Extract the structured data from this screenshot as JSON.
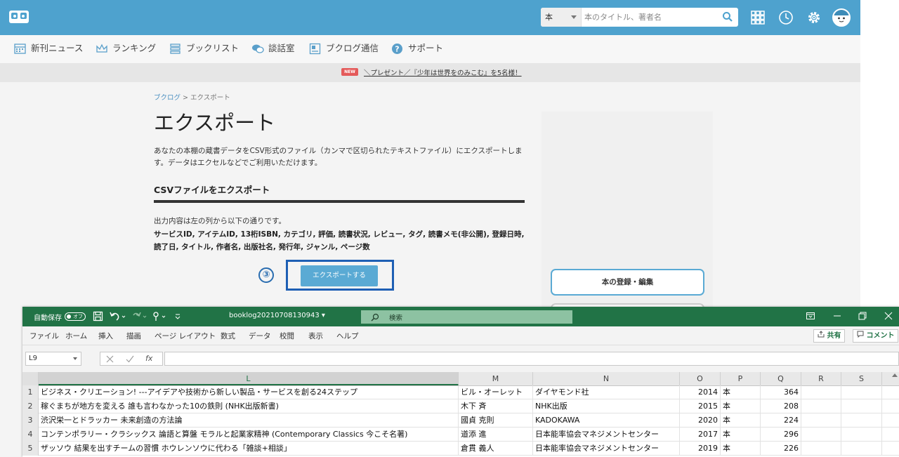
{
  "web": {
    "search": {
      "category": "本",
      "placeholder": "本のタイトル、著者名"
    },
    "nav": [
      {
        "label": "新刊ニュース"
      },
      {
        "label": "ランキング"
      },
      {
        "label": "ブックリスト"
      },
      {
        "label": "談話室"
      },
      {
        "label": "ブクログ通信"
      },
      {
        "label": "サポート"
      }
    ],
    "promo": {
      "badge": "NEW",
      "text": "＼プレゼント／『少年は世界をのみこむ』を5名様！"
    },
    "breadcrumb": {
      "home": "ブクログ",
      "sep": " > ",
      "current": "エクスポート"
    },
    "title": "エクスポート",
    "description": "あなたの本棚の蔵書データをCSV形式のファイル（カンマで区切られたテキストファイル）にエクスポートします。データはエクセルなどでご利用いただけます。",
    "section_title": "CSVファイルをエクスポート",
    "output_intro": "出力内容は左の列から以下の通りです。",
    "output_fields": "サービスID, アイテムID, 13桁ISBN, カテゴリ, 評価, 読書状況, レビュー, タグ, 読書メモ(非公開), 登録日時, 読了日, タイトル, 作者名, 出版社名, 発行年, ジャンル, ページ数",
    "step_marker": "③",
    "export_button": "エクスポートする",
    "side_button": "本の登録・編集"
  },
  "excel": {
    "autosave_label": "自動保存",
    "autosave_state": "オフ",
    "file_name": "booklog20210708130943",
    "search_label": "検索",
    "tabs": [
      "ファイル",
      "ホーム",
      "挿入",
      "描画",
      "ページ レイアウト",
      "数式",
      "データ",
      "校閲",
      "表示",
      "ヘルプ"
    ],
    "share_label": "共有",
    "comment_label": "コメント",
    "name_box": "L9",
    "fx_label": "fx",
    "columns": [
      "L",
      "M",
      "N",
      "O",
      "P",
      "Q",
      "R",
      "S"
    ],
    "rows": [
      {
        "num": "1",
        "L": "ビジネス・クリエーション! ---アイデアや技術から新しい製品・サービスを創る24ステップ",
        "M": "ビル・オーレット",
        "N": "ダイヤモンド社",
        "O": "2014",
        "P": "本",
        "Q": "364"
      },
      {
        "num": "2",
        "L": "稼ぐまちが地方を変える 誰も言わなかった10の鉄則 (NHK出版新書)",
        "M": "木下 斉",
        "N": "NHK出版",
        "O": "2015",
        "P": "本",
        "Q": "208"
      },
      {
        "num": "3",
        "L": "渋沢栄一とドラッカー 未来創造の方法論",
        "M": "國貞 克則",
        "N": "KADOKAWA",
        "O": "2020",
        "P": "本",
        "Q": "224"
      },
      {
        "num": "4",
        "L": "コンテンポラリー・クラシックス 論語と算盤 モラルと起業家精神 (Contemporary Classics 今こそ名著)",
        "M": "道添 進",
        "N": "日本能率協会マネジメントセンター",
        "O": "2017",
        "P": "本",
        "Q": "296"
      },
      {
        "num": "5",
        "L": "ザッソウ 結果を出すチームの習慣 ホウレンソウに代わる「雑談+相談」",
        "M": "倉貫 義人",
        "N": "日本能率協会マネジメントセンター",
        "O": "2019",
        "P": "本",
        "Q": "226"
      }
    ]
  }
}
